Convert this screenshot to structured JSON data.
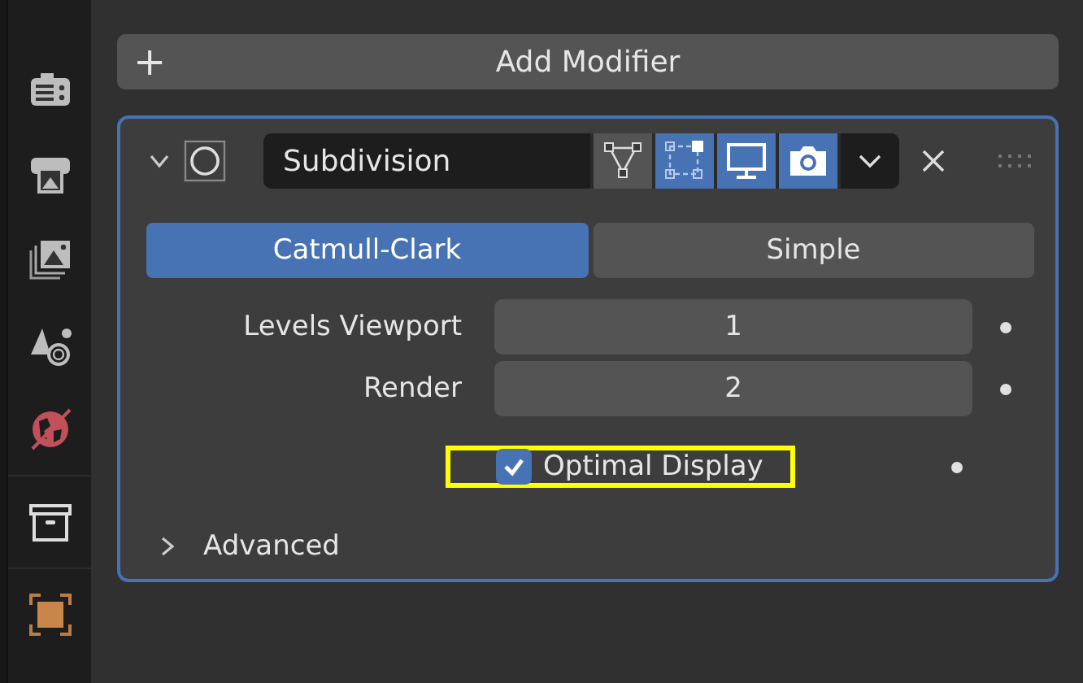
{
  "sidebar": {
    "items": [
      {
        "kind": "tool",
        "selected": false
      },
      {
        "kind": "render",
        "selected": false
      },
      {
        "kind": "output",
        "selected": false
      },
      {
        "kind": "view-layer",
        "selected": false
      },
      {
        "kind": "scene",
        "selected": false
      },
      {
        "kind": "collection",
        "selected": false
      },
      {
        "kind": "object",
        "selected": false
      }
    ]
  },
  "add_modifier": {
    "label": "Add Modifier",
    "icon": "+"
  },
  "modifier": {
    "expanded": true,
    "name": "Subdivision",
    "toggles": [
      {
        "kind": "edit-cage",
        "on": false
      },
      {
        "kind": "edit-mode",
        "on": true
      },
      {
        "kind": "viewport",
        "on": true
      },
      {
        "kind": "render",
        "on": true
      }
    ],
    "tabs": [
      {
        "label": "Catmull-Clark",
        "selected": true
      },
      {
        "label": "Simple",
        "selected": false
      }
    ],
    "fields": [
      {
        "label": "Levels Viewport",
        "value": "1"
      },
      {
        "label": "Render",
        "value": "2"
      }
    ],
    "optimal_display": {
      "label": "Optimal Display",
      "checked": true,
      "highlighted": true
    },
    "advanced": {
      "label": "Advanced",
      "expanded": false
    }
  }
}
